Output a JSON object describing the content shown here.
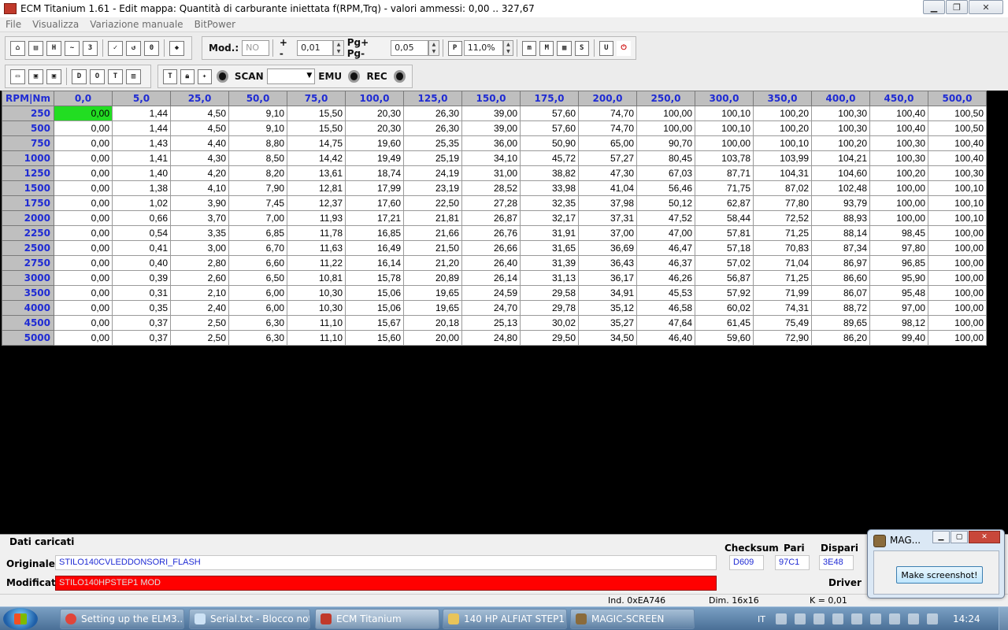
{
  "window": {
    "title": "ECM Titanium 1.61 - Edit mappa: Quantità di carburante iniettata f(RPM,Trq) - valori ammessi: 0,00 .. 327,67"
  },
  "menu": [
    "File",
    "Visualizza",
    "Variazione manuale",
    "BitPower"
  ],
  "toolbar": {
    "mod_label": "Mod.:",
    "mod_value": "NO",
    "plusminus_label": "+ -",
    "plusminus_value": "0,01",
    "pg_label": "Pg+ Pg-",
    "pg_value": "0,05",
    "percent_value": "11,0%",
    "scan_label": "SCAN",
    "scan_value": "",
    "emu_label": "EMU",
    "rec_label": "REC"
  },
  "grid": {
    "corner": "RPM|Nm",
    "columns": [
      "0,0",
      "5,0",
      "25,0",
      "50,0",
      "75,0",
      "100,0",
      "125,0",
      "150,0",
      "175,0",
      "200,0",
      "250,0",
      "300,0",
      "350,0",
      "400,0",
      "450,0",
      "500,0"
    ],
    "rows": [
      {
        "rpm": "250",
        "values": [
          "0,00",
          "1,44",
          "4,50",
          "9,10",
          "15,50",
          "20,30",
          "26,30",
          "39,00",
          "57,60",
          "74,70",
          "100,00",
          "100,10",
          "100,20",
          "100,30",
          "100,40",
          "100,50"
        ]
      },
      {
        "rpm": "500",
        "values": [
          "0,00",
          "1,44",
          "4,50",
          "9,10",
          "15,50",
          "20,30",
          "26,30",
          "39,00",
          "57,60",
          "74,70",
          "100,00",
          "100,10",
          "100,20",
          "100,30",
          "100,40",
          "100,50"
        ]
      },
      {
        "rpm": "750",
        "values": [
          "0,00",
          "1,43",
          "4,40",
          "8,80",
          "14,75",
          "19,60",
          "25,35",
          "36,00",
          "50,90",
          "65,00",
          "90,70",
          "100,00",
          "100,10",
          "100,20",
          "100,30",
          "100,40"
        ]
      },
      {
        "rpm": "1000",
        "values": [
          "0,00",
          "1,41",
          "4,30",
          "8,50",
          "14,42",
          "19,49",
          "25,19",
          "34,10",
          "45,72",
          "57,27",
          "80,45",
          "103,78",
          "103,99",
          "104,21",
          "100,30",
          "100,40"
        ]
      },
      {
        "rpm": "1250",
        "values": [
          "0,00",
          "1,40",
          "4,20",
          "8,20",
          "13,61",
          "18,74",
          "24,19",
          "31,00",
          "38,82",
          "47,30",
          "67,03",
          "87,71",
          "104,31",
          "104,60",
          "100,20",
          "100,30"
        ]
      },
      {
        "rpm": "1500",
        "values": [
          "0,00",
          "1,38",
          "4,10",
          "7,90",
          "12,81",
          "17,99",
          "23,19",
          "28,52",
          "33,98",
          "41,04",
          "56,46",
          "71,75",
          "87,02",
          "102,48",
          "100,00",
          "100,10"
        ]
      },
      {
        "rpm": "1750",
        "values": [
          "0,00",
          "1,02",
          "3,90",
          "7,45",
          "12,37",
          "17,60",
          "22,50",
          "27,28",
          "32,35",
          "37,98",
          "50,12",
          "62,87",
          "77,80",
          "93,79",
          "100,00",
          "100,10"
        ]
      },
      {
        "rpm": "2000",
        "values": [
          "0,00",
          "0,66",
          "3,70",
          "7,00",
          "11,93",
          "17,21",
          "21,81",
          "26,87",
          "32,17",
          "37,31",
          "47,52",
          "58,44",
          "72,52",
          "88,93",
          "100,00",
          "100,10"
        ]
      },
      {
        "rpm": "2250",
        "values": [
          "0,00",
          "0,54",
          "3,35",
          "6,85",
          "11,78",
          "16,85",
          "21,66",
          "26,76",
          "31,91",
          "37,00",
          "47,00",
          "57,81",
          "71,25",
          "88,14",
          "98,45",
          "100,00"
        ]
      },
      {
        "rpm": "2500",
        "values": [
          "0,00",
          "0,41",
          "3,00",
          "6,70",
          "11,63",
          "16,49",
          "21,50",
          "26,66",
          "31,65",
          "36,69",
          "46,47",
          "57,18",
          "70,83",
          "87,34",
          "97,80",
          "100,00"
        ]
      },
      {
        "rpm": "2750",
        "values": [
          "0,00",
          "0,40",
          "2,80",
          "6,60",
          "11,22",
          "16,14",
          "21,20",
          "26,40",
          "31,39",
          "36,43",
          "46,37",
          "57,02",
          "71,04",
          "86,97",
          "96,85",
          "100,00"
        ]
      },
      {
        "rpm": "3000",
        "values": [
          "0,00",
          "0,39",
          "2,60",
          "6,50",
          "10,81",
          "15,78",
          "20,89",
          "26,14",
          "31,13",
          "36,17",
          "46,26",
          "56,87",
          "71,25",
          "86,60",
          "95,90",
          "100,00"
        ]
      },
      {
        "rpm": "3500",
        "values": [
          "0,00",
          "0,31",
          "2,10",
          "6,00",
          "10,30",
          "15,06",
          "19,65",
          "24,59",
          "29,58",
          "34,91",
          "45,53",
          "57,92",
          "71,99",
          "86,07",
          "95,48",
          "100,00"
        ]
      },
      {
        "rpm": "4000",
        "values": [
          "0,00",
          "0,35",
          "2,40",
          "6,00",
          "10,30",
          "15,06",
          "19,65",
          "24,70",
          "29,78",
          "35,12",
          "46,58",
          "60,02",
          "74,31",
          "88,72",
          "97,00",
          "100,00"
        ]
      },
      {
        "rpm": "4500",
        "values": [
          "0,00",
          "0,37",
          "2,50",
          "6,30",
          "11,10",
          "15,67",
          "20,18",
          "25,13",
          "30,02",
          "35,27",
          "47,64",
          "61,45",
          "75,49",
          "89,65",
          "98,12",
          "100,00"
        ]
      },
      {
        "rpm": "5000",
        "values": [
          "0,00",
          "0,37",
          "2,50",
          "6,30",
          "11,10",
          "15,60",
          "20,00",
          "24,80",
          "29,50",
          "34,50",
          "46,40",
          "59,60",
          "72,90",
          "86,20",
          "99,40",
          "100,00"
        ]
      }
    ]
  },
  "panel": {
    "dati_label": "Dati caricati",
    "originale_label": "Originale",
    "originale_value": "STILO140CVLEDDONSORI_FLASH",
    "modificato_label": "Modificato",
    "modificato_value": "STILO140HPSTEP1 MOD",
    "checksum_label": "Checksum",
    "checksum_value": "D609",
    "pari_label": "Pari",
    "pari_value": "97C1",
    "dispari_label": "Dispari",
    "dispari_value": "3E48",
    "driver_label": "Driver"
  },
  "status": {
    "ind": "Ind. 0xEA746",
    "dim": "Dim. 16x16",
    "k": "K = 0,01"
  },
  "magic": {
    "title": "MAG...",
    "button": "Make screenshot!"
  },
  "taskbar": {
    "items": [
      "Setting up the ELM3...",
      "Serial.txt - Blocco note",
      "ECM Titanium",
      "140 HP ALFIAT STEP1",
      "MAGIC-SCREEN"
    ],
    "lang": "IT",
    "clock": "14:24"
  },
  "colors": {
    "header_text": "#1f2bd4",
    "selected_cell": "#22dd22",
    "modified_field": "#ff0000"
  }
}
